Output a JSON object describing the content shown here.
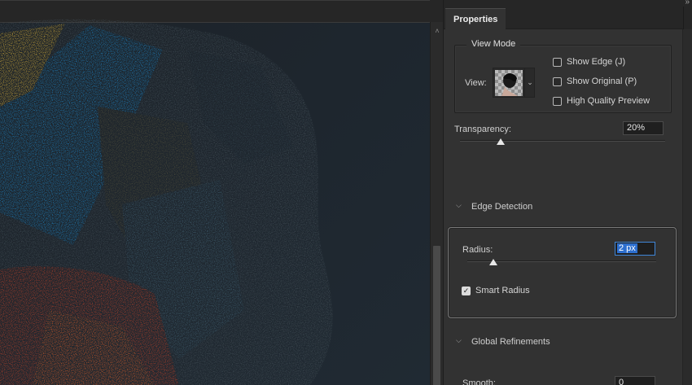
{
  "panel": {
    "tab_label": "Properties",
    "collapse_glyph": "»"
  },
  "view_mode": {
    "title": "View Mode",
    "view_label": "View:",
    "dropdown_glyph": "⌄",
    "options": [
      {
        "label": "Show Edge (J)",
        "checked": false
      },
      {
        "label": "Show Original (P)",
        "checked": false
      },
      {
        "label": "High Quality Preview",
        "checked": false
      }
    ]
  },
  "transparency": {
    "label": "Transparency:",
    "value": "20%",
    "level": 0.2
  },
  "edge_detection": {
    "title": "Edge Detection",
    "radius_label": "Radius:",
    "radius_value": "2 px",
    "radius_level": 0.14,
    "smart_radius_label": "Smart Radius",
    "smart_radius_checked": true
  },
  "global_refinements": {
    "title": "Global Refinements",
    "smooth_label": "Smooth:",
    "smooth_value": "0"
  },
  "scrollbar": {
    "up_glyph": "˄"
  },
  "icons": {
    "chevron": "chevron-down-icon",
    "checkmark": "✓"
  }
}
